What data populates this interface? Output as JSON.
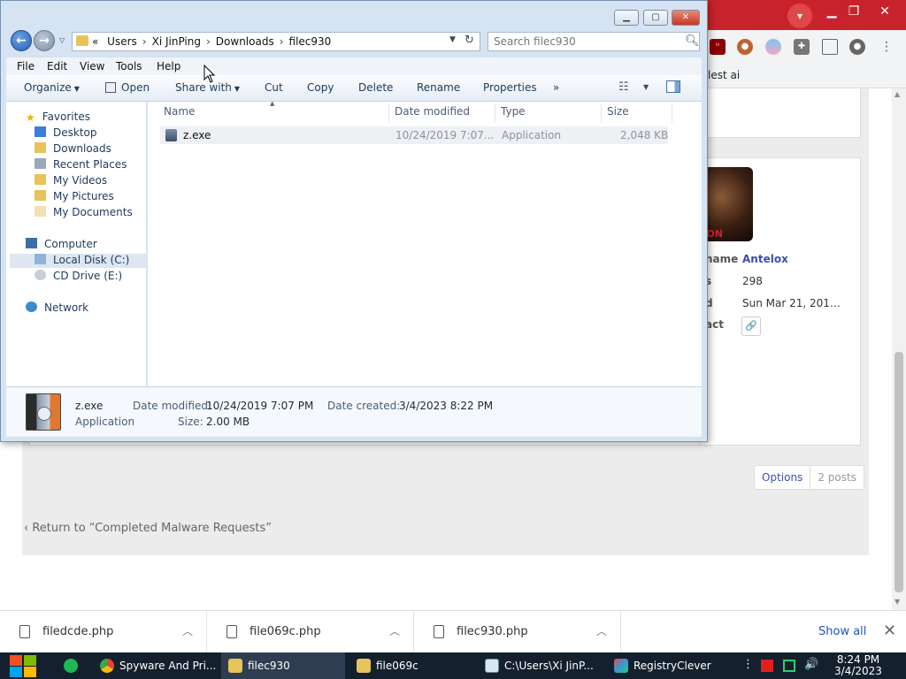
{
  "browser": {
    "bookmark_text": "lest ai",
    "menu_icon": "chevron-down-icon",
    "profile": {
      "username_label": "name",
      "username": "Antelox",
      "posts_label": "s",
      "posts": "298",
      "joined_label": "d",
      "joined": "Sun Mar 21, 201…",
      "contact_label": "act",
      "avatar_text": "EON"
    },
    "pager": {
      "options": "Options",
      "posts": "2 posts"
    },
    "return_link": "Return to “Completed Malware Requests”",
    "accent_color": "#c8232c"
  },
  "downloads": {
    "items": [
      {
        "name": "filedcde.php"
      },
      {
        "name": "file069c.php"
      },
      {
        "name": "filec930.php"
      }
    ],
    "show_all": "Show all"
  },
  "taskbar": {
    "items": [
      {
        "label": "Spyware And Pri..."
      },
      {
        "label": "filec930"
      },
      {
        "label": "file069c"
      },
      {
        "label": "C:\\Users\\Xi JinP..."
      },
      {
        "label": "RegistryClever"
      }
    ],
    "clock_time": "8:24 PM",
    "clock_date": "3/4/2023"
  },
  "explorer": {
    "address": {
      "prefix": "«",
      "crumbs": [
        "Users",
        "Xi JinPing",
        "Downloads",
        "filec930"
      ]
    },
    "search_placeholder": "Search filec930",
    "menu": [
      "File",
      "Edit",
      "View",
      "Tools",
      "Help"
    ],
    "commands": {
      "organize": "Organize",
      "open": "Open",
      "share_with": "Share with",
      "cut": "Cut",
      "copy": "Copy",
      "delete": "Delete",
      "rename": "Rename",
      "properties": "Properties",
      "more": "»"
    },
    "nav": {
      "favorites": "Favorites",
      "desktop": "Desktop",
      "downloads": "Downloads",
      "recent_places": "Recent Places",
      "my_videos": "My Videos",
      "my_pictures": "My Pictures",
      "my_documents": "My Documents",
      "computer": "Computer",
      "local_disk": "Local Disk (C:)",
      "cd_drive": "CD Drive (E:)",
      "network": "Network"
    },
    "columns": {
      "name": "Name",
      "date_modified": "Date modified",
      "type": "Type",
      "size": "Size"
    },
    "files": [
      {
        "name": "z.exe",
        "date_modified": "10/24/2019 7:07...",
        "type": "Application",
        "size": "2,048 KB"
      }
    ],
    "details": {
      "name": "z.exe",
      "type": "Application",
      "date_modified_label": "Date modified:",
      "date_modified": "10/24/2019 7:07 PM",
      "date_created_label": "Date created:",
      "date_created": "3/4/2023 8:22 PM",
      "size_label": "Size:",
      "size": "2.00 MB"
    }
  }
}
